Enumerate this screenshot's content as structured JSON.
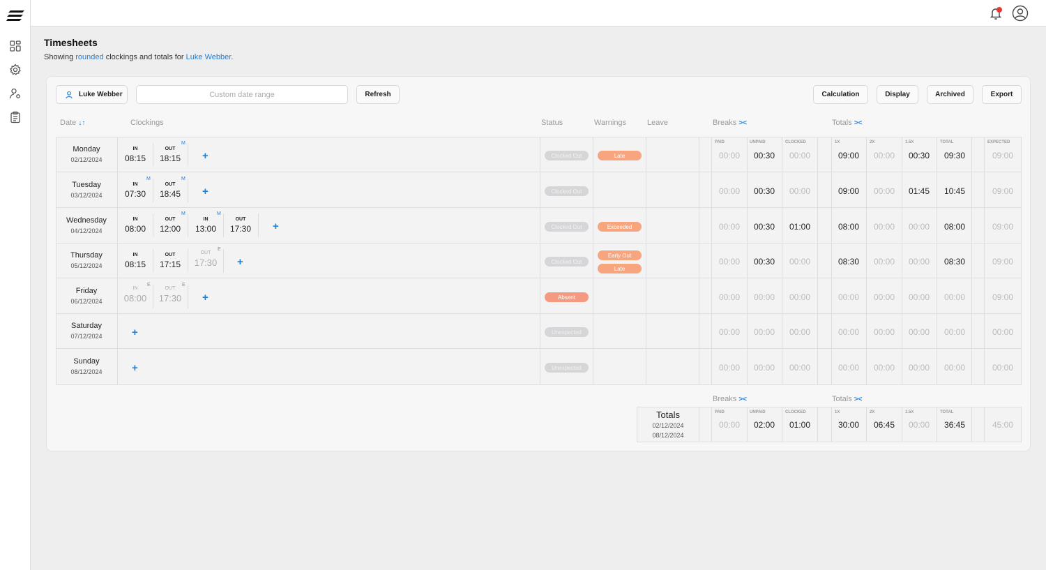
{
  "page": {
    "title": "Timesheets",
    "subtitle_pre": "Showing ",
    "subtitle_link1": "rounded",
    "subtitle_mid": " clockings and totals for ",
    "subtitle_link2": "Luke Webber",
    "subtitle_post": "."
  },
  "notifications": {
    "badge": "1"
  },
  "toolbar": {
    "employee": "Luke Webber",
    "date_placeholder": "Custom date range",
    "refresh": "Refresh",
    "calculation": "Calculation",
    "display": "Display",
    "archived": "Archived",
    "export": "Export"
  },
  "headers": {
    "date": "Date",
    "date_sort": "↓↑",
    "clockings": "Clockings",
    "status": "Status",
    "warnings": "Warnings",
    "leave": "Leave",
    "breaks": "Breaks",
    "totals": "Totals",
    "collapse": "><"
  },
  "subheaders": {
    "paid": "PAID",
    "unpaid": "UNPAID",
    "clocked": "CLOCKED",
    "x1": "1X",
    "x2": "2X",
    "x15": "1.5X",
    "total": "TOTAL",
    "expected": "EXPECTED"
  },
  "labels": {
    "in": "IN",
    "out": "OUT",
    "m": "M",
    "e": "E",
    "plus": "+"
  },
  "rows": [
    {
      "day": "Monday",
      "date": "02/12/2024",
      "status": "Clocked Out",
      "warnings": [
        "Late"
      ],
      "paid": "00:00",
      "unpaid": "00:30",
      "clocked": "00:00",
      "x1": "09:00",
      "x2": "00:00",
      "x15": "00:30",
      "total": "09:30",
      "expected": "09:00"
    },
    {
      "day": "Tuesday",
      "date": "03/12/2024",
      "status": "Clocked Out",
      "warnings": [],
      "paid": "00:00",
      "unpaid": "00:30",
      "clocked": "00:00",
      "x1": "09:00",
      "x2": "00:00",
      "x15": "01:45",
      "total": "10:45",
      "expected": "09:00"
    },
    {
      "day": "Wednesday",
      "date": "04/12/2024",
      "status": "Clocked Out",
      "warnings": [
        "Exceeded"
      ],
      "paid": "00:00",
      "unpaid": "00:30",
      "clocked": "01:00",
      "x1": "08:00",
      "x2": "00:00",
      "x15": "00:00",
      "total": "08:00",
      "expected": "09:00"
    },
    {
      "day": "Thursday",
      "date": "05/12/2024",
      "status": "Clocked Out",
      "warnings": [
        "Early Out",
        "Late"
      ],
      "paid": "00:00",
      "unpaid": "00:30",
      "clocked": "00:00",
      "x1": "08:30",
      "x2": "00:00",
      "x15": "00:00",
      "total": "08:30",
      "expected": "09:00"
    },
    {
      "day": "Friday",
      "date": "06/12/2024",
      "status": "Absent",
      "warnings": [],
      "paid": "00:00",
      "unpaid": "00:00",
      "clocked": "00:00",
      "x1": "00:00",
      "x2": "00:00",
      "x15": "00:00",
      "total": "00:00",
      "expected": "09:00"
    },
    {
      "day": "Saturday",
      "date": "07/12/2024",
      "status": "Unexpected",
      "warnings": [],
      "paid": "00:00",
      "unpaid": "00:00",
      "clocked": "00:00",
      "x1": "00:00",
      "x2": "00:00",
      "x15": "00:00",
      "total": "00:00",
      "expected": "00:00"
    },
    {
      "day": "Sunday",
      "date": "08/12/2024",
      "status": "Unexpected",
      "warnings": [],
      "paid": "00:00",
      "unpaid": "00:00",
      "clocked": "00:00",
      "x1": "00:00",
      "x2": "00:00",
      "x15": "00:00",
      "total": "00:00",
      "expected": "00:00"
    }
  ],
  "clockings": {
    "mon": [
      {
        "t": "08:15"
      },
      {
        "t": "18:15"
      }
    ],
    "tue": [
      {
        "t": "07:30"
      },
      {
        "t": "18:45"
      }
    ],
    "wed": [
      {
        "t": "08:00"
      },
      {
        "t": "12:00"
      },
      {
        "t": "13:00"
      },
      {
        "t": "17:30"
      }
    ],
    "thu": [
      {
        "t": "08:15"
      },
      {
        "t": "17:15"
      },
      {
        "t": "17:30"
      }
    ],
    "fri": [
      {
        "t": "08:00"
      },
      {
        "t": "17:30"
      }
    ]
  },
  "summary": {
    "label": "Totals",
    "from": "02/12/2024",
    "to": "08/12/2024",
    "paid": "00:00",
    "unpaid": "02:00",
    "clocked": "01:00",
    "x1": "30:00",
    "x2": "06:45",
    "x15": "00:00",
    "total": "36:45",
    "expected": "45:00"
  },
  "colors": {
    "accent": "#1e7fd6",
    "warning": "#f7a57f",
    "absent": "#f59a80",
    "status_pill": "#d6d6d8"
  }
}
